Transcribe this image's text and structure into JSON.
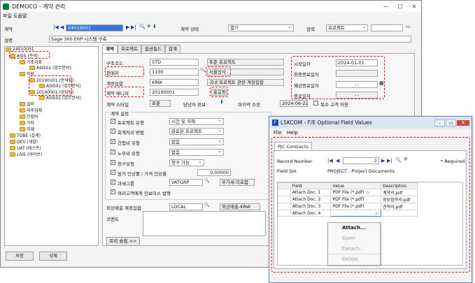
{
  "main": {
    "title": "DEMOCO - 계약 관리",
    "menu": "파일 도움말",
    "contract_label": "계약",
    "contract_value": "24010001",
    "status_label": "계약 상태",
    "status_value": "열기",
    "search_label": "검색",
    "search_value": "프로젝트",
    "desc_label": "설명",
    "desc_value": "Sage 300 ERP 시스템 구축",
    "save": "저장",
    "delete": "삭제"
  },
  "tree": [
    "24010001",
    "ASIS (분석)",
    "기초자료",
    "ASIS01 (업무분석)",
    "직원",
    "20190101 (분석팀)",
    "ASIS01 (업무분석)",
    "20190001 (상담팀)",
    "ASIS01 (업무분석)",
    "설비",
    "외주업체",
    "간접비",
    "기타",
    "자재",
    "TOBE (설계)",
    "DEV (개발)",
    "UAT (테스트)",
    "LIVE (라이브)"
  ],
  "tabs": [
    "계약",
    "프로젝트",
    "옵션필드",
    "합계"
  ],
  "form": {
    "structure_label": "구조코드",
    "structure_value": "STD",
    "structure_desc": "표준 프로젝트",
    "vendor_label": "판매처",
    "vendor_value": "1100",
    "vendor_desc": "서울상사",
    "acct_label": "계정집합",
    "acct_value": "KRW",
    "acct_desc": "국내 프로젝트 관련 계정집합",
    "mgr_label": "계약 매니저",
    "mgr_value": "20190001",
    "mgr_desc": "홍길동",
    "style_label": "계약 스타일",
    "style_value": "표준",
    "contact_label": "담당자 정보",
    "modified_label": "마지막 수정",
    "modified_value": "2024-06-22",
    "multi_label": "복수 고객 허용",
    "start_label": "시작일자",
    "start_value": "2024-01-01",
    "final_label": "최종종료일자",
    "est_label": "예상종료일자",
    "est_value": "- -",
    "end_label": "종료일자",
    "end_value": "- -"
  },
  "settings": {
    "title": "계약 설정",
    "rows": [
      {
        "label": "프로젝트 유형",
        "value": "시간 및 자재"
      },
      {
        "label": "회계처리 방법",
        "value": "완료된 프로젝트"
      },
      {
        "label": "간접비 유형",
        "value": "없음"
      },
      {
        "label": "노무비 유형",
        "value": "없음"
      },
      {
        "label": "청구유형",
        "value": "청구 가능"
      },
      {
        "label": "원가 인상률 / 가격 인상율",
        "value": "0.00000"
      },
      {
        "label": "과세그룹",
        "value": "VATGRP"
      },
      {
        "label": "여러고객에게 인보이스 발행",
        "value": ""
      },
      {
        "label": "외상매출 계정집합",
        "value": "LOCAL"
      }
    ],
    "tax_desc": "부가세 미포함",
    "ar_desc": "외상매출-KRW",
    "comment_label": "코멘트",
    "history_btn": "토리 슬림 >>"
  },
  "popup": {
    "title": "LSKCOM - F/E Optional Field Values",
    "menu_file": "File",
    "menu_help": "Help",
    "tab": "PJC Contracts",
    "record_label": "Record Number",
    "record_value": "1",
    "required": "* Required",
    "fieldset_label": "Field Set",
    "fieldset_value": "PROJECT - Project Documents",
    "headers": [
      "Field",
      "Value",
      "Description"
    ],
    "rows": [
      {
        "field": "Attach Doc. 1",
        "value": "PDF File (*.pdf)",
        "desc": "계약서.pdf"
      },
      {
        "field": "Attach Doc. 2",
        "value": "PDF File (*.pdf)",
        "desc": "정보협약서.pdf"
      },
      {
        "field": "Attach Doc. 3",
        "value": "PDF File (*.pdf)",
        "desc": "견적서.pdf"
      },
      {
        "field": "Attach Doc. 4",
        "value": "",
        "desc": ""
      }
    ],
    "context": [
      "Attach...",
      "Open",
      "Detach...",
      "Delete"
    ]
  }
}
